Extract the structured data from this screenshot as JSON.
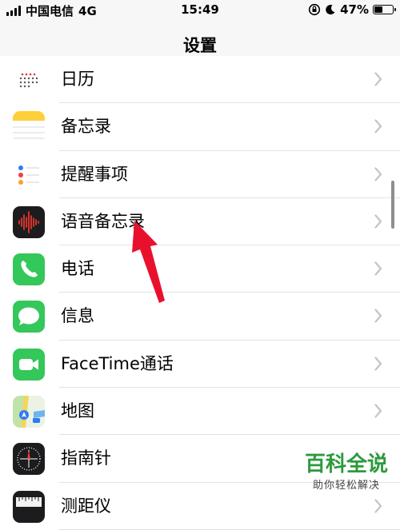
{
  "status_bar": {
    "carrier": "中国电信",
    "network": "4G",
    "time": "15:49",
    "battery_text": "47%",
    "battery_level": 0.47
  },
  "nav": {
    "title": "设置"
  },
  "rows": [
    {
      "label": "日历",
      "icon": "calendar-icon"
    },
    {
      "label": "备忘录",
      "icon": "notes-icon"
    },
    {
      "label": "提醒事项",
      "icon": "reminders-icon"
    },
    {
      "label": "语音备忘录",
      "icon": "voice-memos-icon"
    },
    {
      "label": "电话",
      "icon": "phone-icon"
    },
    {
      "label": "信息",
      "icon": "messages-icon"
    },
    {
      "label": "FaceTime通话",
      "icon": "facetime-icon"
    },
    {
      "label": "地图",
      "icon": "maps-icon"
    },
    {
      "label": "指南针",
      "icon": "compass-icon"
    },
    {
      "label": "测距仪",
      "icon": "measure-icon"
    }
  ],
  "watermark": {
    "main": "百科全说",
    "sub": "助你轻松解决"
  },
  "colors": {
    "green": "#34c759",
    "chevron": "#c4c4c7",
    "annotation_arrow": "#e8112d"
  }
}
